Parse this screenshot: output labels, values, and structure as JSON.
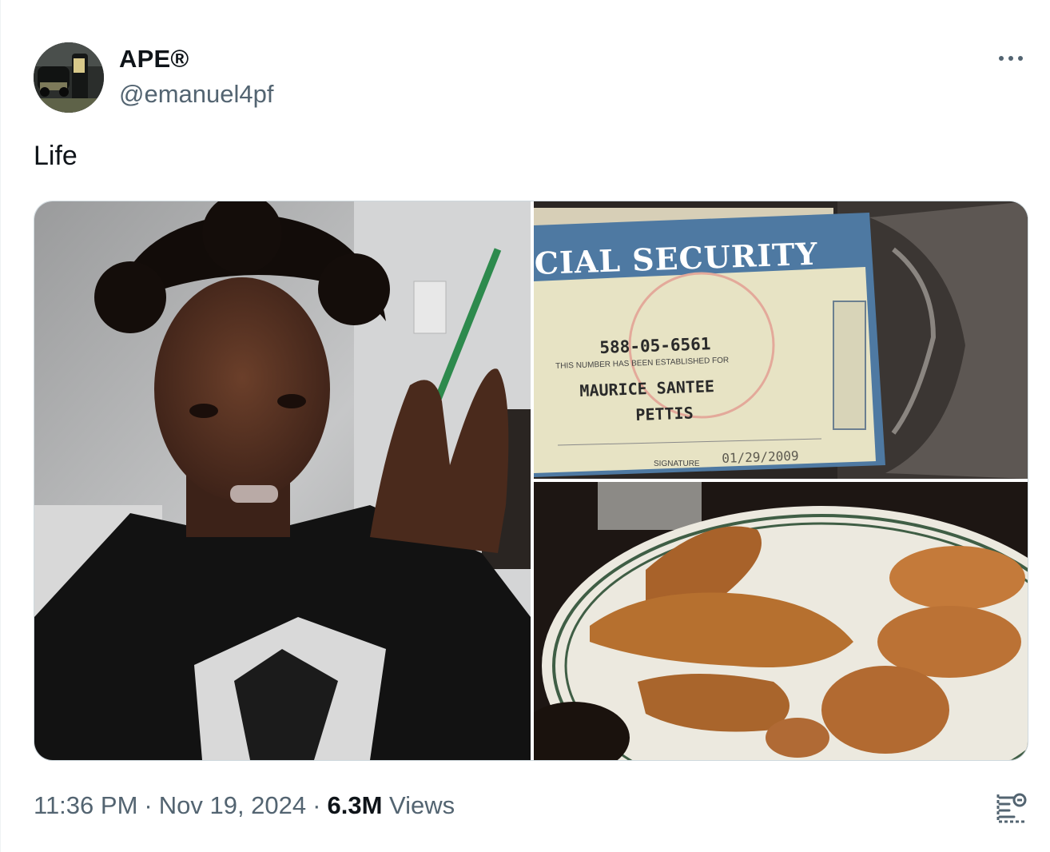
{
  "author": {
    "display_name": "APE®",
    "handle": "@emanuel4pf",
    "avatar_icon": "avatar-photo"
  },
  "tweet": {
    "text": "Life"
  },
  "media": [
    {
      "name": "selfie-photo",
      "description_icon": "photo"
    },
    {
      "name": "social-security-card-photo",
      "card_text": {
        "header": "CIAL SECURITY",
        "number": "588-05-6561",
        "established": "THIS NUMBER HAS BEEN ESTABLISHED FOR",
        "name_line1": "MAURICE SANTEE",
        "name_line2": "PETTIS",
        "signature_label": "SIGNATURE",
        "date": "01/29/2009"
      }
    },
    {
      "name": "chicken-and-waffles-photo"
    }
  ],
  "footer": {
    "time": "11:36 PM",
    "date": "Nov 19, 2024",
    "views_count": "6.3M",
    "views_label": "Views",
    "separator": "·"
  },
  "colors": {
    "text_primary": "#0f1419",
    "text_secondary": "#536471",
    "border": "#cfd9de"
  },
  "icons": {
    "more": "more-horizontal-icon",
    "analytics": "analytics-icon"
  }
}
